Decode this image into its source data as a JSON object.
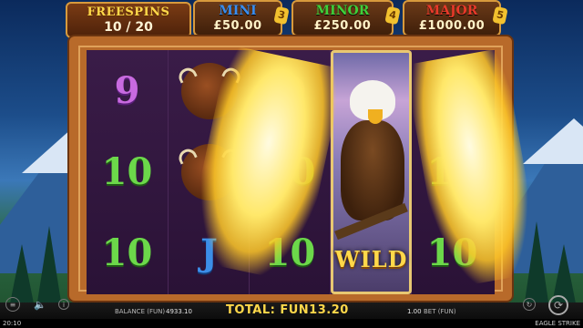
{
  "freespins": {
    "label": "FREESPINS",
    "count": "10 / 20"
  },
  "jackpots": [
    {
      "name": "MINI",
      "value": "£50.00",
      "badge": "3",
      "color": "#3a8ef0"
    },
    {
      "name": "MINOR",
      "value": "£250.00",
      "badge": "4",
      "color": "#3fcf3a"
    },
    {
      "name": "MAJOR",
      "value": "£1000.00",
      "badge": "5",
      "color": "#e83a2a"
    }
  ],
  "reels": [
    [
      "9",
      "10",
      "10"
    ],
    [
      "buffalo",
      "buffalo",
      "J"
    ],
    [
      "Q",
      "10",
      "10"
    ],
    [
      "eagle-wild",
      "eagle-wild",
      "eagle-wild"
    ],
    [
      "9",
      "10",
      "10"
    ]
  ],
  "wild_label": "WILD",
  "bottom": {
    "balance_label": "BALANCE (FUN)",
    "balance_value": "4933.10",
    "total_label": "TOTAL:",
    "total_value": "FUN13.20",
    "bet_value": "1.00",
    "bet_label": "BET (FUN)",
    "time": "20:10",
    "game_name": "EAGLE STRIKE"
  },
  "icons": [
    "menu-icon",
    "sound-icon",
    "info-icon",
    "spin-icon",
    "autoplay-icon"
  ]
}
